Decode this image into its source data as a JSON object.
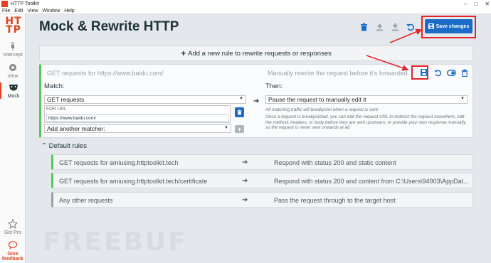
{
  "window": {
    "title": "HTTP Toolkit"
  },
  "menu": [
    "File",
    "Edit",
    "View",
    "Window",
    "Help"
  ],
  "sidebar": {
    "logo": "HTTP",
    "items": [
      {
        "label": "Intercept",
        "icon": "plug-icon"
      },
      {
        "label": "View",
        "icon": "eye-icon"
      },
      {
        "label": "Mock",
        "icon": "theater-mask-icon"
      }
    ],
    "bottom": [
      {
        "label": "Get Pro",
        "icon": "star-icon"
      },
      {
        "label": "Give feedback",
        "icon": "speech-bubble-icon"
      }
    ]
  },
  "watermark": "FREEBUF",
  "header": {
    "title": "Mock & Rewrite HTTP",
    "save_label": "Save changes",
    "tools": [
      "delete-all-icon",
      "import-icon",
      "export-icon",
      "reset-icon"
    ]
  },
  "add_rule": {
    "label": "Add a new rule to rewrite requests or responses"
  },
  "rule": {
    "summary_match": "GET requests for https://www.baidu.com/",
    "summary_handler": "Manually rewrite the request before it's forwarded",
    "match_label": "Match:",
    "then_label": "Then:",
    "method_select": "GET requests",
    "url_caption": "FOR URL",
    "url_value": "https://www.baidu.com/",
    "add_matcher": "Add another matcher:",
    "handler_select": "Pause the request to manually edit it",
    "desc1": "All matching traffic will breakpoint when a request is sent.",
    "desc2": "Once a request is breakpointed, you can edit the request URL to redirect the request elsewhere, edit the method, headers, or body before they are sent upstream, or provide your own response manually so the request is never sent onwards at all."
  },
  "default_rules": {
    "label": "Default rules",
    "rows": [
      {
        "match": "GET requests for amiusing.httptoolkit.tech",
        "handler": "Respond with status 200 and static content"
      },
      {
        "match": "GET requests for amiusing.httptoolkit.tech/certificate",
        "handler": "Respond with status 200 and content from C:\\Users\\94903\\AppDat..."
      },
      {
        "match": "Any other requests",
        "handler": "Pass the request through to the target host"
      }
    ]
  },
  "colors": {
    "accent": "#1b6cc8",
    "brand": "#e1421f",
    "highlight": "#e0262a",
    "rule_active": "#57c75a"
  }
}
